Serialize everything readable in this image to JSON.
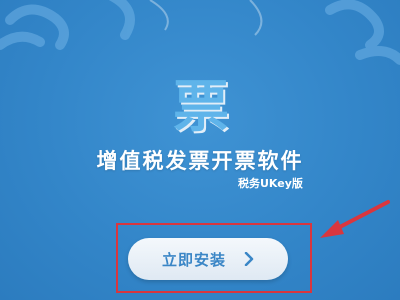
{
  "app": {
    "logo_char": "票",
    "title": "增值税发票开票软件",
    "subtitle": "税务UKey版"
  },
  "actions": {
    "install_label": "立即安装",
    "install_icon": "chevron-right-icon"
  },
  "colors": {
    "background": "#3386c9",
    "button_text": "#3a86c6",
    "highlight": "#d9363e",
    "arrow": "#d9363e"
  }
}
